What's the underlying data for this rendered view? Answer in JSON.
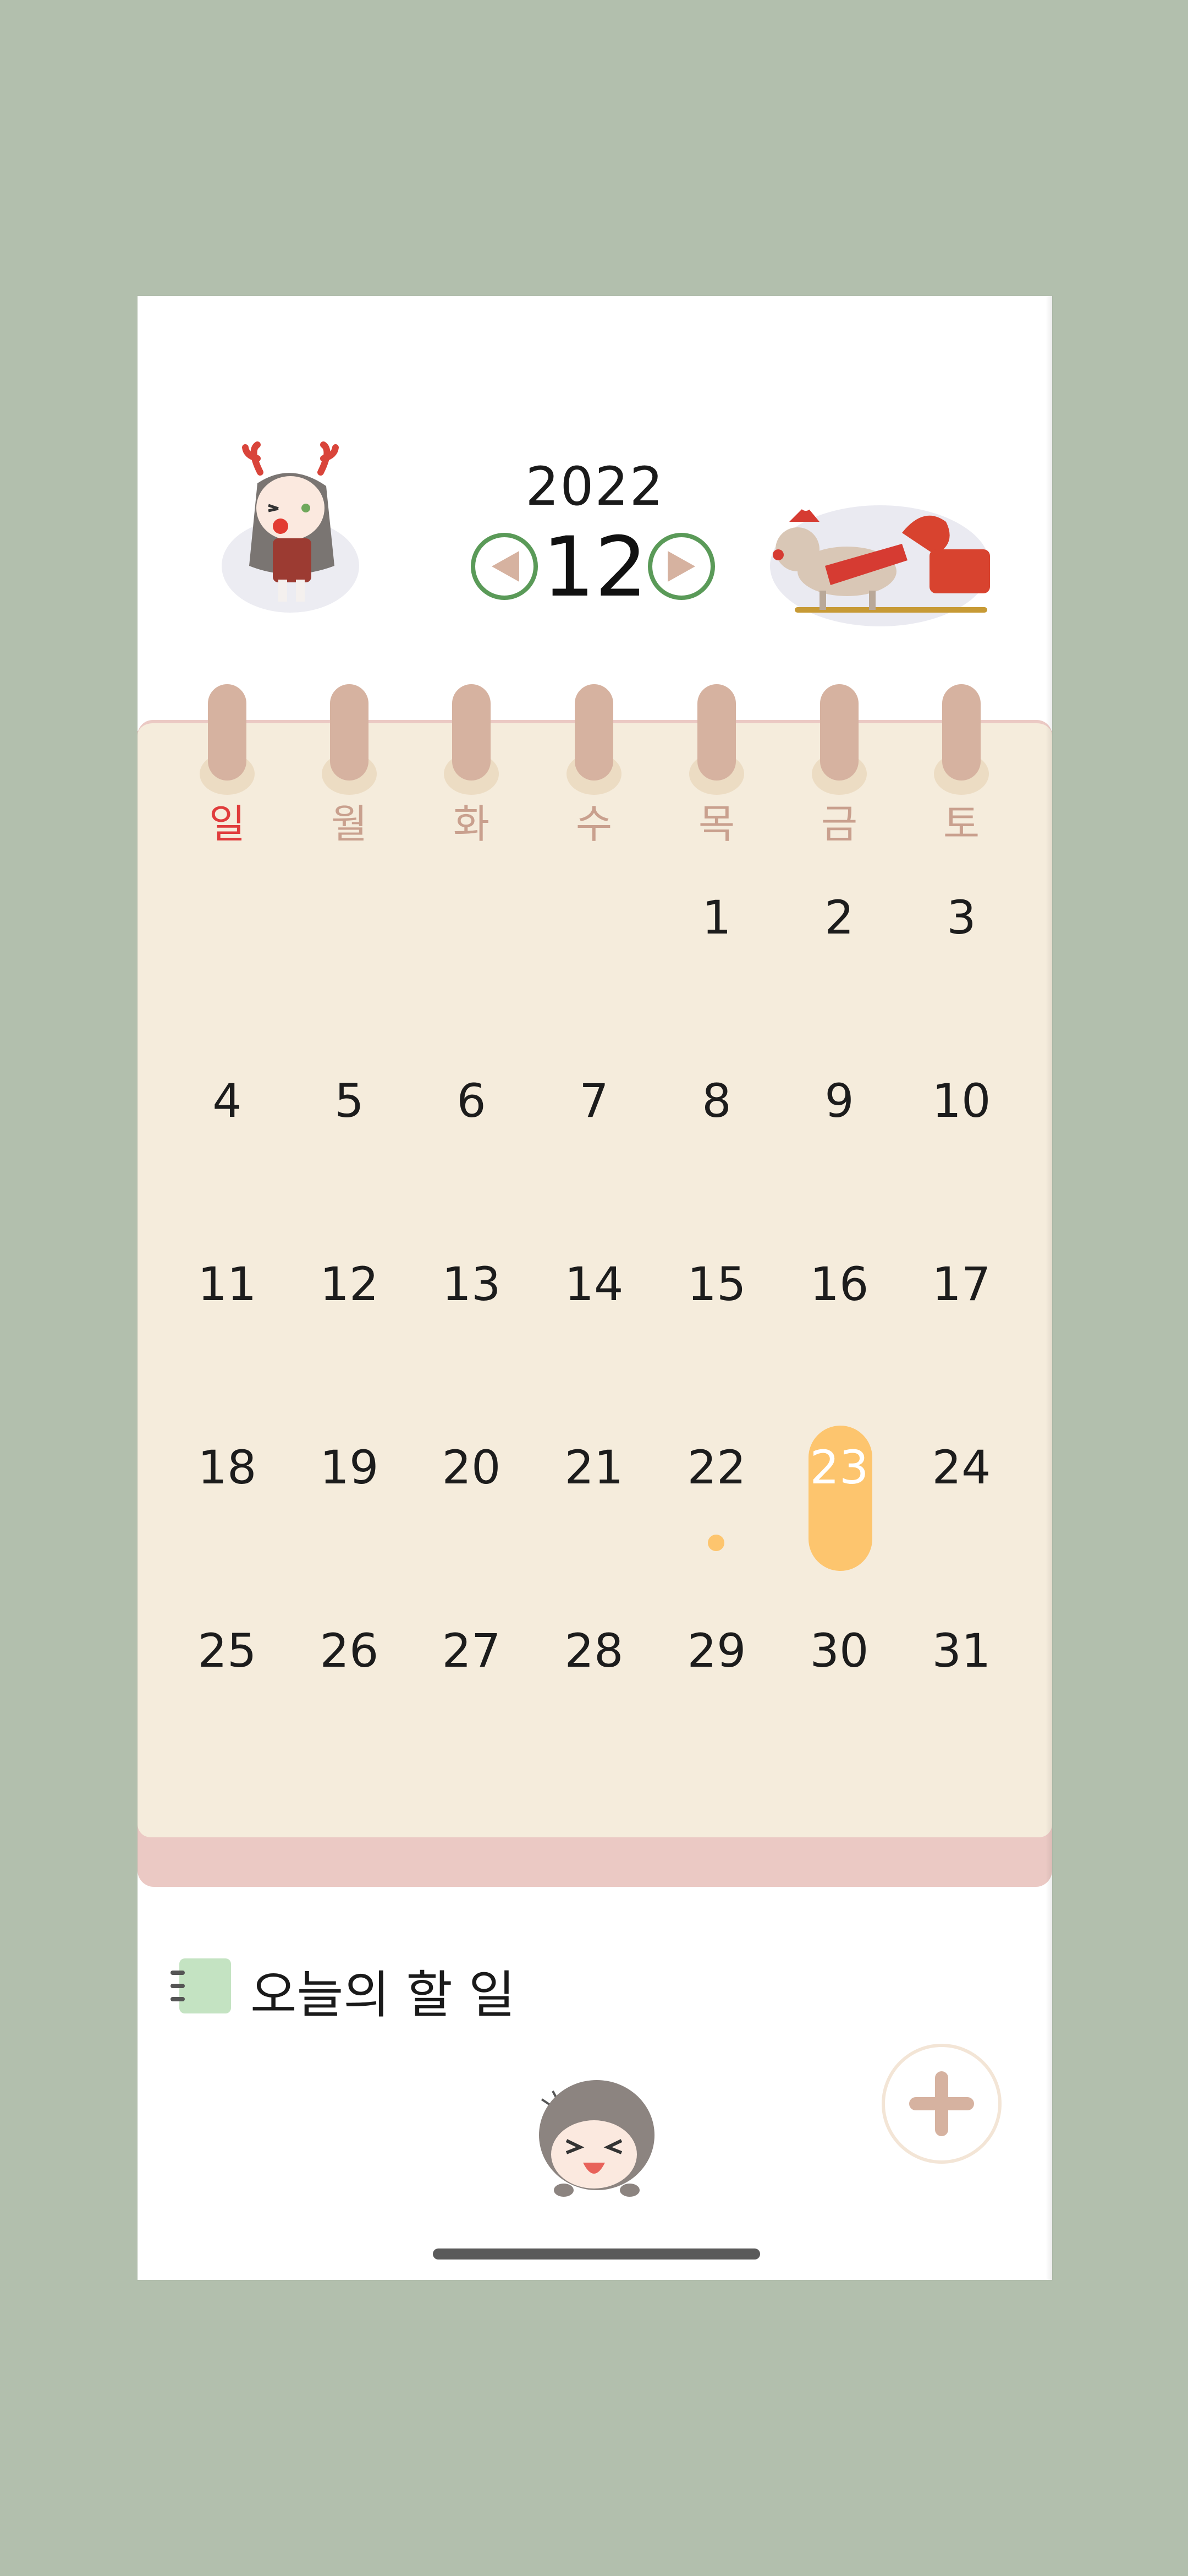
{
  "header": {
    "year": "2022",
    "month": "12",
    "prev_icon": "triangle-left-icon",
    "next_icon": "triangle-right-icon"
  },
  "calendar": {
    "weekdays": [
      "일",
      "월",
      "화",
      "수",
      "목",
      "금",
      "토"
    ],
    "weeks": [
      [
        "",
        "",
        "",
        "",
        "1",
        "2",
        "3"
      ],
      [
        "4",
        "5",
        "6",
        "7",
        "8",
        "9",
        "10"
      ],
      [
        "11",
        "12",
        "13",
        "14",
        "15",
        "16",
        "17"
      ],
      [
        "18",
        "19",
        "20",
        "21",
        "22",
        "23",
        "24"
      ],
      [
        "25",
        "26",
        "27",
        "28",
        "29",
        "30",
        "31"
      ]
    ],
    "today": "23",
    "event_day": "22"
  },
  "todo": {
    "title": "오늘의 할 일",
    "icon": "notebook-icon",
    "add_icon": "plus-icon"
  },
  "colors": {
    "background": "#b2bfad",
    "card": "#f5ecdc",
    "today_highlight": "#fdc56e",
    "nav_ring": "#5a9a58",
    "nav_arrow": "#d6b2a0",
    "sunday": "#e03c3c",
    "weekday": "#c9a08e"
  }
}
